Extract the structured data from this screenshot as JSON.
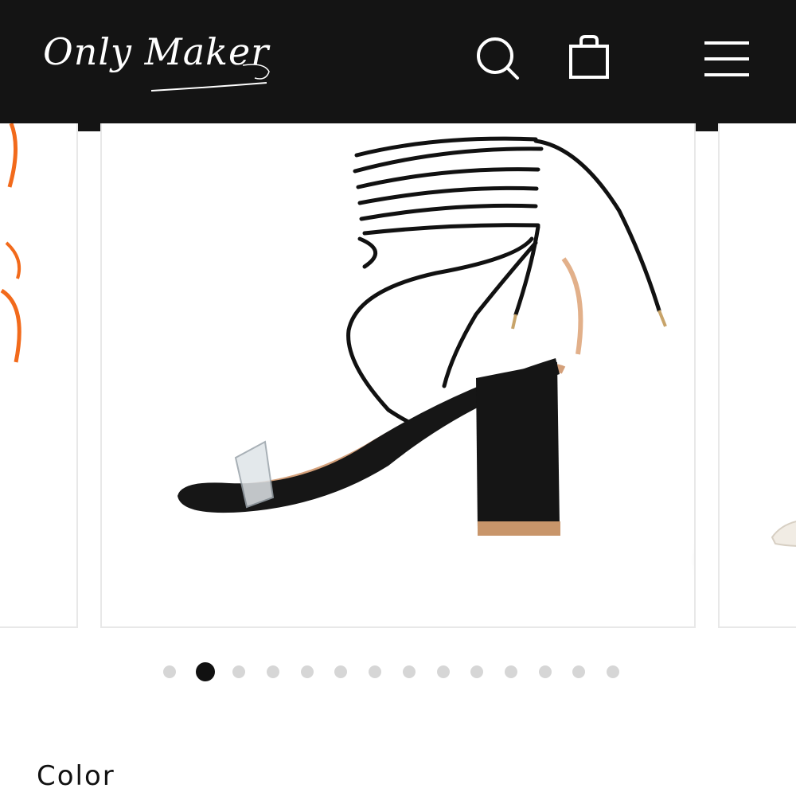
{
  "header": {
    "logo_text": "Only Maker",
    "search_icon": "search-icon",
    "cart_icon": "shopping-bag-icon",
    "menu_icon": "hamburger-menu-icon",
    "background_color": "#141414"
  },
  "carousel": {
    "total_slides": 14,
    "active_index": 1,
    "zoom_icon": "magnify-icon"
  },
  "product": {
    "color_label": "Color"
  }
}
